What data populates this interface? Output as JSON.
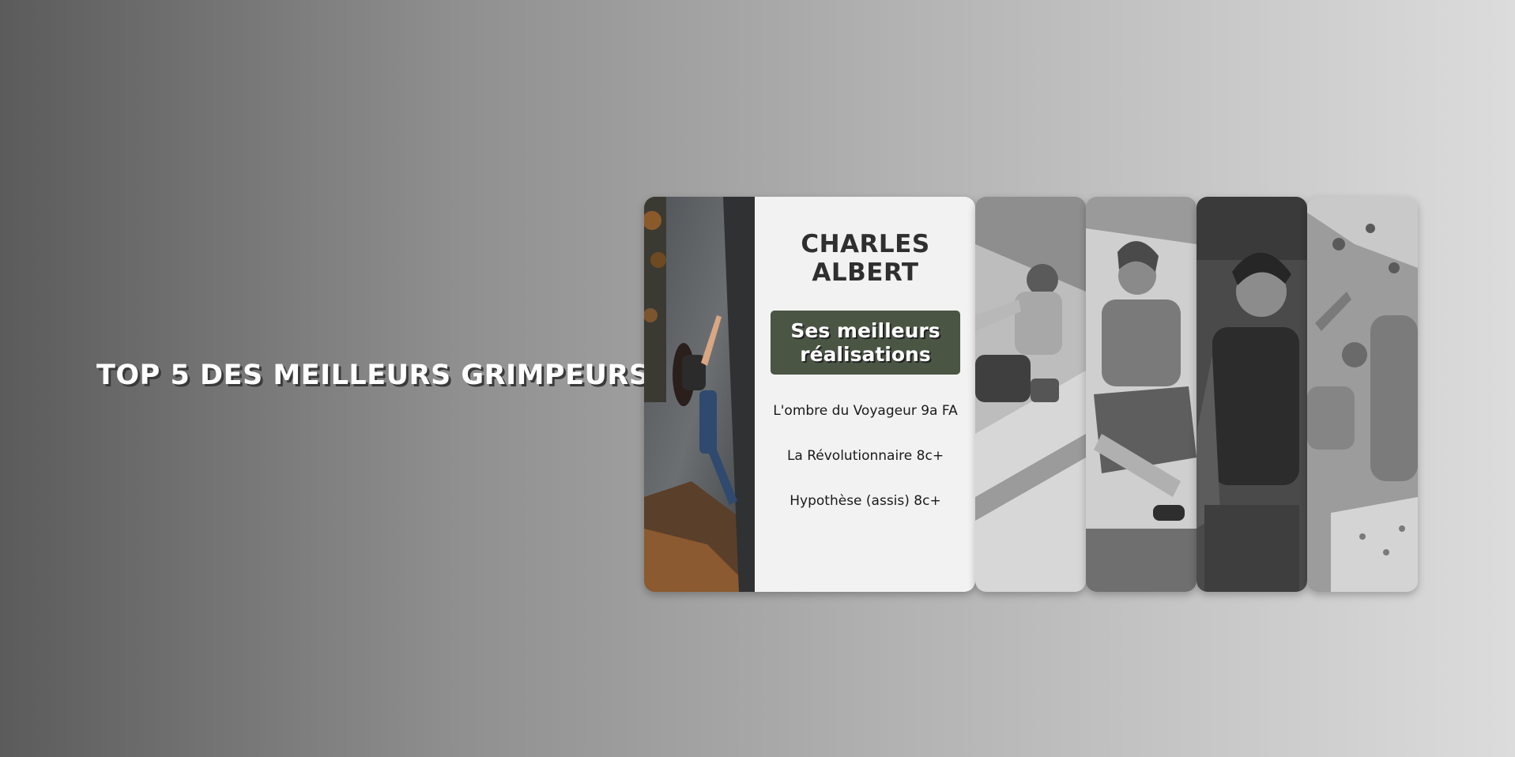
{
  "page": {
    "title": "TOP 5 DES MEILLEURS GRIMPEURS"
  },
  "featured": {
    "name_line1": "CHARLES",
    "name_line2": "ALBERT",
    "button_label": "Ses meilleurs réalisations",
    "achievements": [
      "L'ombre du Voyageur 9a FA",
      "La Révolutionnaire 8c+",
      "Hypothèse (assis) 8c+"
    ]
  },
  "colors": {
    "button_bg": "#4a5543",
    "card_bg": "#f2f2f2",
    "title_text": "#ffffff"
  }
}
